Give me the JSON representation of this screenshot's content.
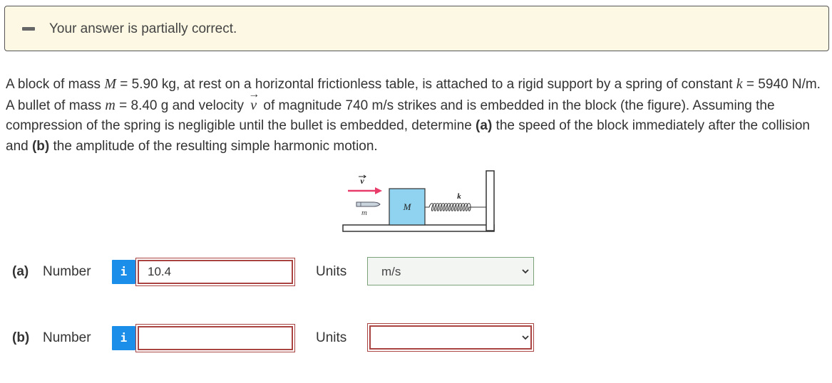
{
  "banner": {
    "message": "Your answer is partially correct."
  },
  "problem": {
    "t1": "A block of mass ",
    "M": "M",
    "t2": " = 5.90 kg, at rest on a horizontal frictionless table, is attached to a rigid support by a spring of constant ",
    "k": "k",
    "t3": " = 5940 N/m. A bullet of mass ",
    "m": "m",
    "t4": " = 8.40 g and velocity ",
    "v": "v",
    "t5": " of magnitude 740 m/s strikes and is embedded in the block (the figure). Assuming the compression of the spring is negligible until the bullet is embedded, determine ",
    "a_tag": "(a)",
    "t6": " the speed of the block immediately after the collision and ",
    "b_tag": "(b)",
    "t7": " the amplitude of the resulting simple harmonic motion."
  },
  "figure": {
    "v_label": "v",
    "m_label": "m",
    "M_label": "M",
    "k_label": "k"
  },
  "answers": [
    {
      "part": "(a)",
      "label": "Number",
      "info": "i",
      "value": "10.4",
      "units_label": "Units",
      "units_value": "m/s",
      "status": "correct"
    },
    {
      "part": "(b)",
      "label": "Number",
      "info": "i",
      "value": "",
      "units_label": "Units",
      "units_value": "",
      "status": "incorrect"
    }
  ],
  "colors": {
    "info": "#1a8ee8",
    "error": "#a94442",
    "ok": "#7aa37a",
    "banner_bg": "#fcf8e3",
    "block": "#8fd3f0",
    "velocity_arrow": "#e83c6b"
  }
}
